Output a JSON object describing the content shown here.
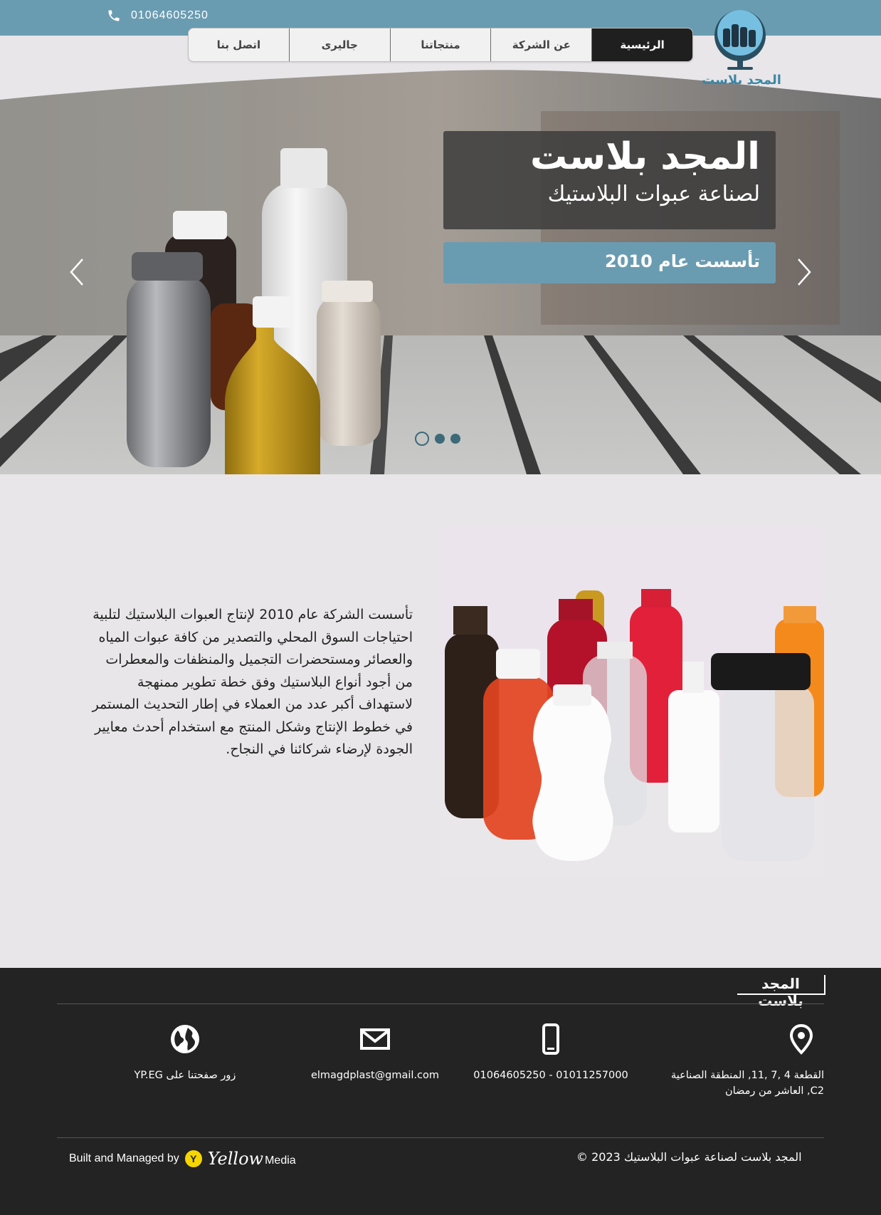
{
  "topbar": {
    "phone": "01064605250",
    "phone_icon": "phone-icon"
  },
  "nav": {
    "items": [
      {
        "label": "الرئيسية",
        "active": true
      },
      {
        "label": "عن الشركة",
        "active": false
      },
      {
        "label": "منتجاتنا",
        "active": false
      },
      {
        "label": "جاليرى",
        "active": false
      },
      {
        "label": "اتصل بنا",
        "active": false
      }
    ]
  },
  "logo": {
    "text": "المجد بلاست"
  },
  "hero": {
    "headline": "المجد بلاست",
    "subline": "لصناعة عبوات البلاستيك",
    "founded": "تأسست عام 2010",
    "prev_icon": "chevron-left-icon",
    "next_icon": "chevron-right-icon",
    "slide_count": 3,
    "active_slide": 1
  },
  "about": {
    "text": "تأسست الشركة عام 2010 لإنتاج العبوات البلاستيك لتلبية احتياجات السوق المحلي والتصدير من كافة عبوات المياه والعصائر ومستحضرات التجميل والمنظفات والمعطرات من أجود أنواع البلاستيك وفق خطة تطوير ممنهجة لاستهداف أكبر عدد من العملاء في إطار التحديث المستمر في خطوط الإنتاج وشكل المنتج مع استخدام أحدث معايير الجودة لإرضاء شركائنا في النجاح."
  },
  "footer": {
    "logo_text": "المجد بلاست",
    "address": "القطعة 4 ,7 ,11, المنطقة الصناعية C2, العاشر من رمضان",
    "phones": "01011257000 - 01064605250",
    "email": "elmagdplast@gmail.com",
    "website": "زور صفحتنا على YP.EG",
    "copyright": "© المجد بلاست لصناعة عبوات البلاستيك 2023",
    "built_by": "Built and Managed by",
    "brand_badge": "Y",
    "brand_name": "Yellow",
    "brand_suffix": "Media",
    "colors": {
      "topbar": "#6a9cb1",
      "footer": "#232323",
      "nav_active": "#1f1f1f"
    }
  }
}
